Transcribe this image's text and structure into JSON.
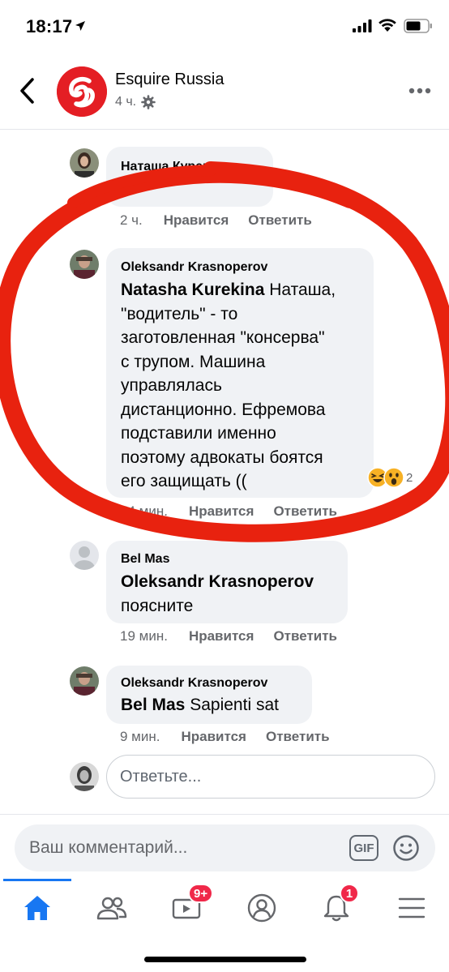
{
  "status_bar": {
    "time": "18:17"
  },
  "header": {
    "page_name": "Esquire Russia",
    "time_ago": "4 ч."
  },
  "comments": [
    {
      "author": "Наташа Курекина",
      "partial_text": "",
      "time": "2 ч.",
      "like": "Нравится",
      "reply": "Ответить"
    },
    {
      "author": "Oleksandr Krasnoperov",
      "mention": "Natasha Kurekina",
      "lines": [
        "Наташа,",
        "\"водитель\" - то",
        "заготовленная \"консерва\"",
        "с трупом. Машина",
        "управлялась",
        "дистанционно. Ефремова",
        "подставили  именно",
        "поэтому адвокаты боятся",
        "его защищать (("
      ],
      "reaction_count": "2",
      "time": "54 мин.",
      "like": "Нравится",
      "reply": "Ответить"
    },
    {
      "author": "Bel Mas",
      "mention": "Oleksandr Krasnoperov",
      "text": "поясните",
      "time": "19 мин.",
      "like": "Нравится",
      "reply": "Ответить"
    },
    {
      "author": "Oleksandr Krasnoperov",
      "mention": "Bel Mas",
      "text": "Sapienti sat",
      "time": "9 мин.",
      "like": "Нравится",
      "reply": "Ответить"
    }
  ],
  "reply_box": {
    "placeholder": "Ответьте..."
  },
  "comment_bar": {
    "placeholder": "Ваш комментарий...",
    "gif_label": "GIF"
  },
  "tabs": {
    "video_badge": "9+",
    "notifications_badge": "1"
  },
  "colors": {
    "accent": "#1877f2",
    "badge": "#f02849",
    "annotation_red": "#e8220f",
    "brand": "#e41e24"
  }
}
